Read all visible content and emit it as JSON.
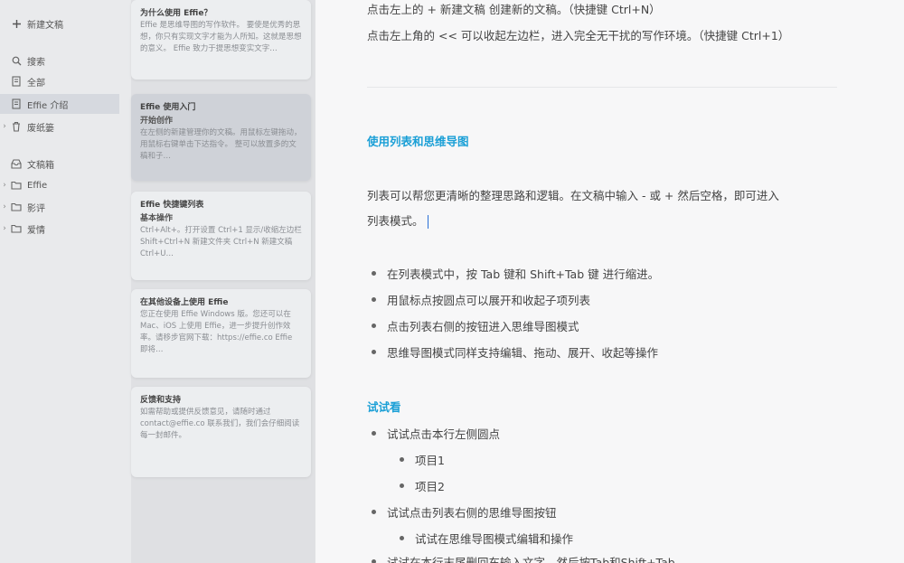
{
  "sidebar": {
    "new_doc": "新建文稿",
    "items": [
      {
        "label": "搜索",
        "icon": "search-icon"
      },
      {
        "label": "全部",
        "icon": "document-icon"
      },
      {
        "label": "Effie 介绍",
        "icon": "document-icon"
      },
      {
        "label": "废纸篓",
        "icon": "trash-icon"
      }
    ],
    "library": "文稿箱",
    "folders": [
      {
        "label": "Effie"
      },
      {
        "label": "影评"
      },
      {
        "label": "爱情"
      }
    ]
  },
  "notes": [
    {
      "title": "为什么使用 Effie？",
      "subtitle": "",
      "preview": "Effie 是思维导图的写作软件。 要使是优秀的思想，你只有实现文字才能为人所知。这就是思想的意义。 Effie 致力于提思想变实文字…"
    },
    {
      "title": "Effie 使用入门",
      "subtitle": "开始创作",
      "preview": "在左侧的新建管理你的文稿。用鼠标左键拖动，用鼠标右键单击下达指令。 整可以放置多的文稿和子…"
    },
    {
      "title": "Effie 快捷键列表",
      "subtitle": "基本操作",
      "preview": "Ctrl+Alt+。打开设置 Ctrl+1 显示/收缩左边栏 Shift+Ctrl+N 新建文件夹 Ctrl+N 新建文稿 Ctrl+U…"
    },
    {
      "title": "在其他设备上使用 Effie",
      "subtitle": "",
      "preview": "您正在使用 Effie Windows 版。您还可以在Mac、iOS 上使用 Effie，进一步提升创作效率。请移步官网下载：https://effie.co Effie 即将…"
    },
    {
      "title": "反馈和支持",
      "subtitle": "",
      "preview": "如需帮助或提供反馈意见，请随时通过 contact@effie.co 联系我们，我们会仔细阅读每一封邮件。"
    }
  ],
  "editor": {
    "line1": "点击左上的 + 新建文稿 创建新的文稿。（快捷键 Ctrl+N）",
    "line2": "点击左上角的 << 可以收起左边栏，进入完全无干扰的写作环境。（快捷键 Ctrl+1）",
    "heading1": "使用列表和思维导图",
    "para1": "列表可以帮您更清晰的整理思路和逻辑。在文稿中输入 - 或 + 然后空格，即可进入",
    "para2": "列表模式。",
    "bullets": [
      "在列表模式中，按 Tab 键和 Shift+Tab 键 进行缩进。",
      "用鼠标点按圆点可以展开和收起子项列表",
      "点击列表右侧的按钮进入思维导图模式",
      "思维导图模式同样支持编辑、拖动、展开、收起等操作"
    ],
    "heading2": "试试看",
    "try": {
      "item1": "试试点击本行左侧圆点",
      "sub1": "项目1",
      "sub2": "项目2",
      "item2": "试试点击列表右侧的思维导图按钮",
      "sub3": "试试在思维导图模式编辑和操作",
      "item3": "试试在本行末尾删回车输入文字，然后按Tab和Shift+Tab"
    }
  }
}
